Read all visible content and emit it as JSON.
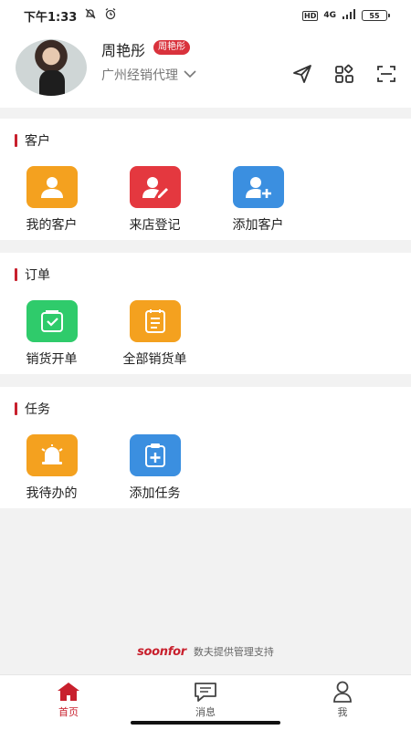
{
  "status_bar": {
    "time": "下午1:33",
    "network": "4G",
    "hd": "HD",
    "battery": "55"
  },
  "profile": {
    "name": "周艳彤",
    "tag": "周艳彤",
    "role": "广州经销代理"
  },
  "header_icons": [
    "send-icon",
    "apps-grid-icon",
    "scan-icon"
  ],
  "sections": [
    {
      "title": "客户",
      "tiles": [
        {
          "label": "我的客户",
          "icon": "user-icon",
          "color": "#f4a11f"
        },
        {
          "label": "来店登记",
          "icon": "user-edit-icon",
          "color": "#e4383f"
        },
        {
          "label": "添加客户",
          "icon": "add-user-icon",
          "color": "#3b8fe0"
        }
      ]
    },
    {
      "title": "订单",
      "tiles": [
        {
          "label": "销货开单",
          "icon": "bag-check-icon",
          "color": "#2fcb6b"
        },
        {
          "label": "全部销货单",
          "icon": "document-list-icon",
          "color": "#f4a11f"
        }
      ]
    },
    {
      "title": "任务",
      "tiles": [
        {
          "label": "我待办的",
          "icon": "bell-icon",
          "color": "#f4a11f"
        },
        {
          "label": "添加任务",
          "icon": "clipboard-add-icon",
          "color": "#3b8fe0"
        }
      ]
    }
  ],
  "footer": {
    "brand": "soonfor",
    "text": "数夫提供管理支持"
  },
  "tabbar": [
    {
      "label": "首页",
      "icon": "home-icon",
      "active": true
    },
    {
      "label": "消息",
      "icon": "message-icon",
      "active": false
    },
    {
      "label": "我",
      "icon": "person-icon",
      "active": false
    }
  ],
  "colors": {
    "accent": "#c8202d",
    "orange": "#f4a11f",
    "red": "#e4383f",
    "blue": "#3b8fe0",
    "green": "#2fcb6b"
  }
}
